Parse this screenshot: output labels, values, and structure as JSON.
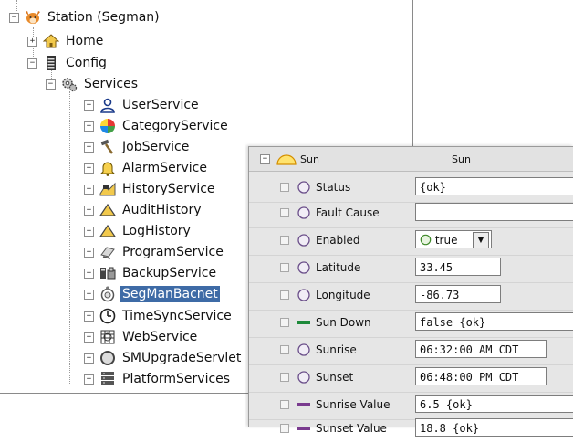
{
  "tree": {
    "station": {
      "label": "Station (Segman)",
      "icon": "fox-station-icon"
    },
    "home": {
      "label": "Home",
      "icon": "home-icon"
    },
    "config": {
      "label": "Config",
      "icon": "config-icon"
    },
    "services": {
      "label": "Services",
      "icon": "services-gears-icon"
    },
    "items": [
      {
        "label": "UserService",
        "icon": "user-icon"
      },
      {
        "label": "CategoryService",
        "icon": "category-icon"
      },
      {
        "label": "JobService",
        "icon": "job-icon"
      },
      {
        "label": "AlarmService",
        "icon": "alarm-bell-icon"
      },
      {
        "label": "HistoryService",
        "icon": "history-icon"
      },
      {
        "label": "AuditHistory",
        "icon": "audit-history-icon"
      },
      {
        "label": "LogHistory",
        "icon": "log-history-icon"
      },
      {
        "label": "ProgramService",
        "icon": "program-icon"
      },
      {
        "label": "BackupService",
        "icon": "backup-icon"
      },
      {
        "label": "SegManBacnet",
        "icon": "segman-bacnet-icon",
        "selected": true
      },
      {
        "label": "TimeSyncService",
        "icon": "clock-icon"
      },
      {
        "label": "WebService",
        "icon": "web-icon"
      },
      {
        "label": "SMUpgradeServlet",
        "icon": "servlet-icon"
      },
      {
        "label": "PlatformServices",
        "icon": "platform-icon"
      }
    ]
  },
  "props": {
    "header": {
      "name": "Sun",
      "value": "Sun",
      "icon": "sun-icon"
    },
    "rows": [
      {
        "label": "Status",
        "value": "{ok}",
        "icon": "circle-icon"
      },
      {
        "label": "Fault Cause",
        "value": "",
        "icon": "circle-icon"
      },
      {
        "label": "Enabled",
        "value": "true",
        "icon": "circle-icon",
        "type": "select"
      },
      {
        "label": "Latitude",
        "value": "33.45",
        "icon": "circle-icon"
      },
      {
        "label": "Longitude",
        "value": "-86.73",
        "icon": "circle-icon"
      },
      {
        "label": "Sun Down",
        "value": "false {ok}",
        "icon": "green-bar-icon"
      },
      {
        "label": "Sunrise",
        "value": "06:32:00 AM CDT",
        "icon": "circle-icon"
      },
      {
        "label": "Sunset",
        "value": "06:48:00 PM CDT",
        "icon": "circle-icon"
      },
      {
        "label": "Sunrise Value",
        "value": "6.5 {ok}",
        "icon": "purple-bar-icon"
      },
      {
        "label": "Sunset Value",
        "value": "18.8 {ok}",
        "icon": "purple-bar-icon"
      }
    ]
  },
  "colors": {
    "selection": "#3e6ba6",
    "green_bar": "#1e8a3a",
    "purple_bar": "#7a3b8f"
  }
}
